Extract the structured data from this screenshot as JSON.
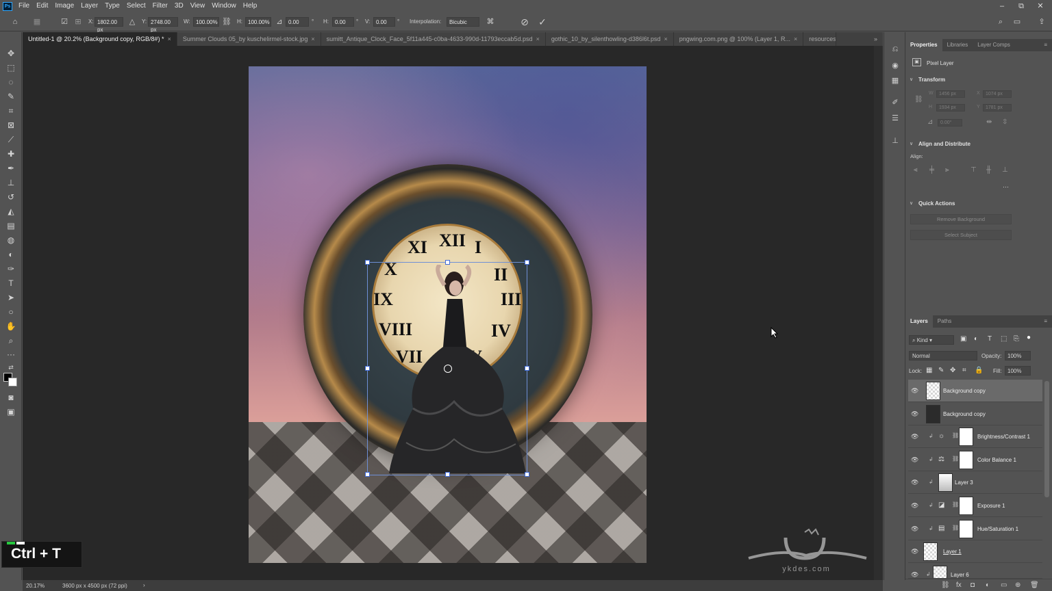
{
  "app": {
    "logo": "Ps"
  },
  "menu": [
    "File",
    "Edit",
    "Image",
    "Layer",
    "Type",
    "Select",
    "Filter",
    "3D",
    "View",
    "Window",
    "Help"
  ],
  "window_controls": {
    "minimize": "–",
    "restore": "⧉",
    "close": "✕"
  },
  "options": {
    "x_label": "X:",
    "x_value": "1802.00 px",
    "y_label": "Y:",
    "y_value": "2748.00 px",
    "w_label": "W:",
    "w_value": "100.00%",
    "h_label": "H:",
    "h_value": "100.00%",
    "angle_value": "0.00",
    "hskew_label": "H:",
    "hskew_value": "0.00",
    "vskew_label": "V:",
    "vskew_value": "0.00",
    "interpolation_label": "Interpolation:",
    "interpolation_value": "Bicubic",
    "cancel_glyph": "⊘",
    "commit_glyph": "✓"
  },
  "tabs": [
    {
      "label": "Untitled-1 @ 20.2% (Background copy, RGB/8#) *",
      "close": "×"
    },
    {
      "label": "Summer Clouds 05_by kuschelirmel-stock.jpg",
      "close": "×"
    },
    {
      "label": "sumitt_Antique_Clock_Face_5f11a445-c0ba-4633-990d-11793eccab5d.psd",
      "close": "×"
    },
    {
      "label": "gothic_10_by_silenthowling-d386l6t.psd",
      "close": "×"
    },
    {
      "label": "pngwing.com.png @ 100% (Layer 1, R...",
      "close": "×"
    },
    {
      "label": "resources",
      "close": ""
    }
  ],
  "tab_overflow": "»",
  "clock_numerals": [
    "XII",
    "I",
    "II",
    "III",
    "IV",
    "V",
    "VII",
    "VIII",
    "IX",
    "X",
    "XI"
  ],
  "shortcut": {
    "text": "Ctrl + T",
    "led_colors": [
      "#27c93f",
      "#ffffff"
    ]
  },
  "watermark": {
    "text": "ykdes.com"
  },
  "status": {
    "zoom": "20.17%",
    "doc_info": "3600 px x 4500 px (72 ppi)",
    "arrow": "›"
  },
  "properties": {
    "tabs": [
      "Properties",
      "Libraries",
      "Layer Comps"
    ],
    "layer_kind": "Pixel Layer",
    "transform_title": "Transform",
    "w_label": "W",
    "w_value": "1456 px",
    "x_label": "X",
    "x_value": "1074 px",
    "h_label": "H",
    "h_value": "1934 px",
    "y_label": "Y",
    "y_value": "1781 px",
    "angle_value": "0.00°",
    "align_title": "Align and Distribute",
    "align_label": "Align:",
    "more": "···",
    "quick_title": "Quick Actions",
    "remove_bg": "Remove Background",
    "select_subject": "Select Subject"
  },
  "layers": {
    "tabs": [
      "Layers",
      "Paths"
    ],
    "filter_value": "Kind",
    "blend_mode": "Normal",
    "opacity_label": "Opacity:",
    "opacity_value": "100%",
    "lock_label": "Lock:",
    "fill_label": "Fill:",
    "fill_value": "100%",
    "items": [
      {
        "name": "Background copy"
      },
      {
        "name": "Background copy"
      },
      {
        "name": "Brightness/Contrast 1"
      },
      {
        "name": "Color Balance 1"
      },
      {
        "name": "Layer 3"
      },
      {
        "name": "Exposure 1"
      },
      {
        "name": "Hue/Saturation 1"
      },
      {
        "name": "Layer 1"
      },
      {
        "name": "Layer 6"
      }
    ],
    "footer_icons": [
      "link-icon",
      "fx-icon",
      "mask-icon",
      "adjustment-icon",
      "group-icon",
      "new-layer-icon",
      "trash-icon"
    ]
  }
}
